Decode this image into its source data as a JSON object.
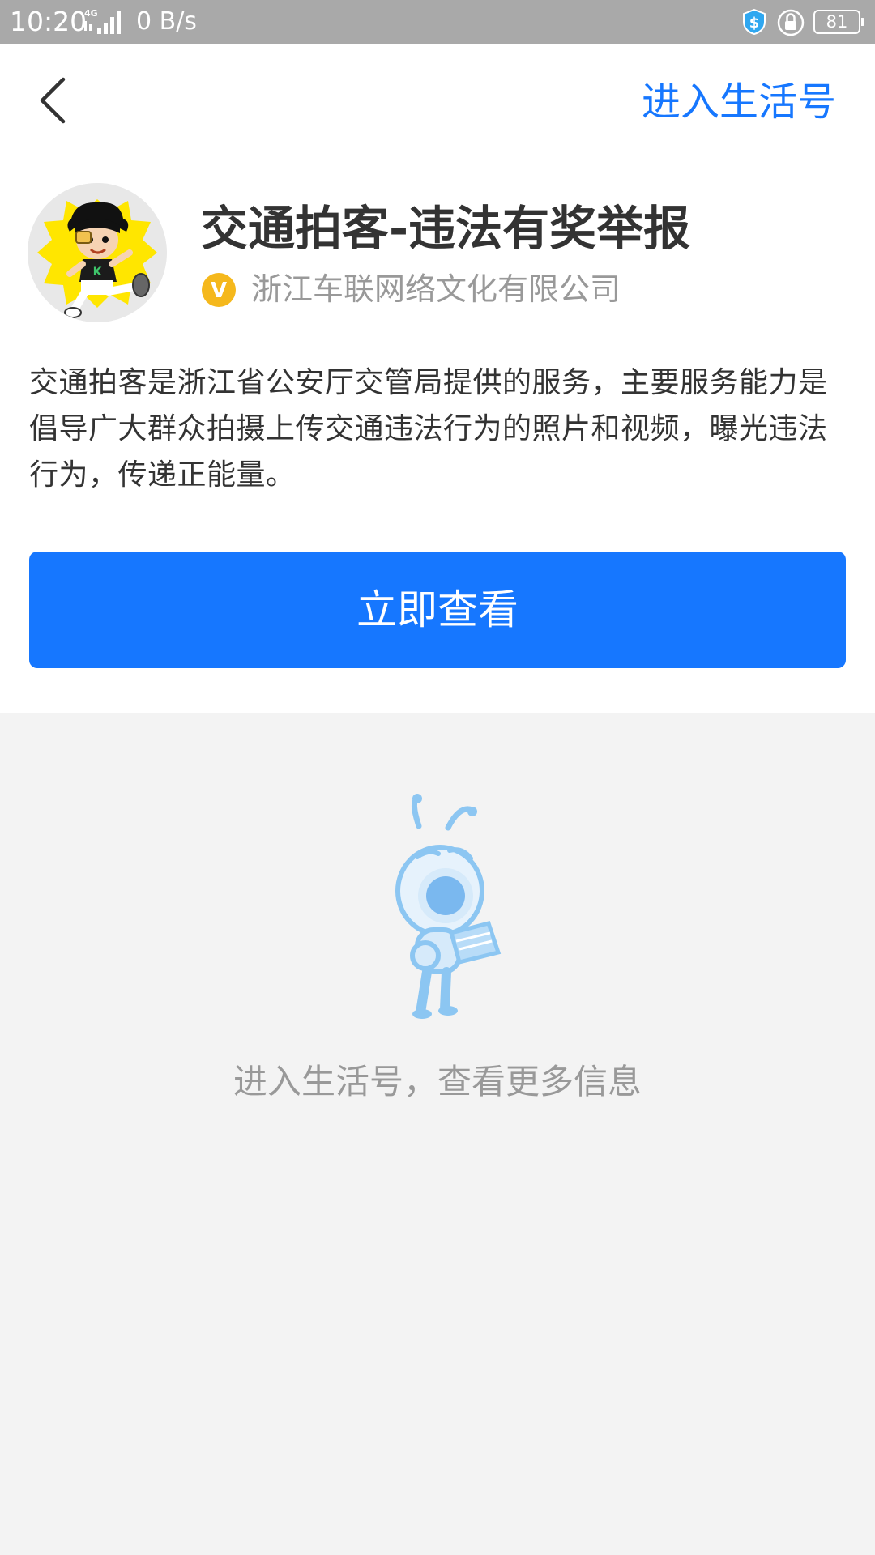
{
  "status_bar": {
    "time": "10:20",
    "network": "4G",
    "speed": "0 B/s",
    "battery": "81",
    "icons": [
      "signal-icon",
      "shield-icon",
      "lock-icon",
      "battery-icon"
    ]
  },
  "header": {
    "back_icon": "chevron-left-icon",
    "enter_link": "进入生活号"
  },
  "account": {
    "avatar_icon": "cartoon-avatar",
    "name": "交通拍客-违法有奖举报",
    "verified_icon": "verified-v-icon",
    "company": "浙江车联网络文化有限公司",
    "description": "交通拍客是浙江省公安厅交管局提供的服务，主要服务能力是倡导广大群众拍摄上传交通违法行为的照片和视频，曝光违法行为，传递正能量。"
  },
  "actions": {
    "view_button": "立即查看"
  },
  "empty_state": {
    "mascot_icon": "ant-mascot-icon",
    "hint": "进入生活号，查看更多信息"
  },
  "colors": {
    "accent": "#1677ff",
    "background": "#f3f3f3",
    "status_bar": "#a9a9a9",
    "badge": "#f5b81c"
  }
}
